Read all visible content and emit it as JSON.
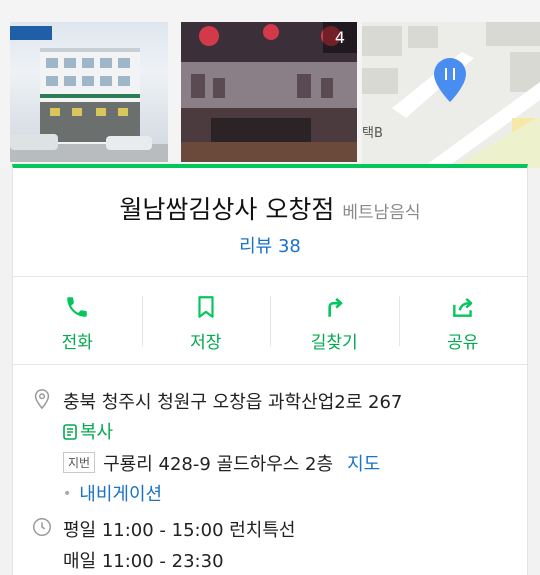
{
  "photos": {
    "count": "4",
    "map_label": "택B"
  },
  "place": {
    "name": "월남쌈김상사 오창점",
    "category": "베트남음식",
    "reviews": "리뷰 38"
  },
  "actions": {
    "call": "전화",
    "save": "저장",
    "directions": "길찾기",
    "share": "공유"
  },
  "info": {
    "address": "충북 청주시 청원구 오창읍 과학산업2로 267",
    "copy": "복사",
    "jibun_badge": "지번",
    "jibun_address": "구룡리 428-9 골드하우스 2층",
    "map_link": "지도",
    "navigation": "내비게이션",
    "hours_weekday": "평일 11:00 - 15:00 런치특선",
    "hours_daily": "매일 11:00 - 23:30"
  },
  "colors": {
    "accent": "#03c75a",
    "link": "#1a73c8"
  }
}
